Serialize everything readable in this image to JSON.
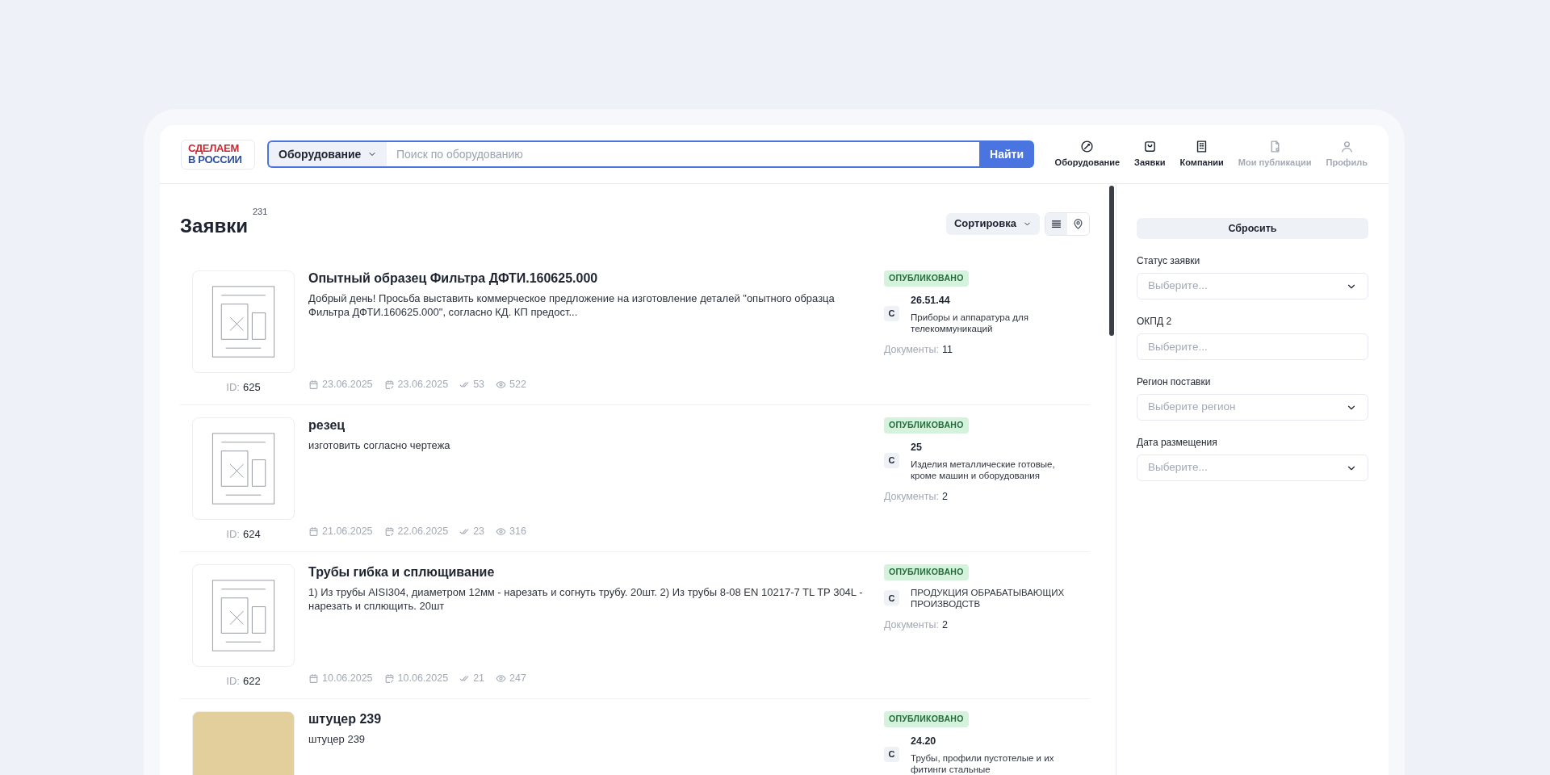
{
  "logo": [
    "СДЕЛАЕМ",
    "В РОССИИ"
  ],
  "search": {
    "category": "Оборудование",
    "placeholder": "Поиск по оборудованию",
    "button": "Найти"
  },
  "nav": [
    {
      "label": "Оборудование",
      "disabled": false
    },
    {
      "label": "Заявки",
      "disabled": false
    },
    {
      "label": "Компании",
      "disabled": false
    },
    {
      "label": "Мои публикации",
      "disabled": true
    },
    {
      "label": "Профиль",
      "disabled": true
    }
  ],
  "heading": {
    "title": "Заявки",
    "count": "231"
  },
  "sort": {
    "label": "Сортировка"
  },
  "view_toggle": [
    {
      "selected": true
    },
    {
      "selected": false
    }
  ],
  "requests": [
    {
      "kind": "drawing",
      "id_label": "ID:",
      "id": "625",
      "title": "Опытный образец Фильтра ДФТИ.160625.000",
      "description": "Добрый день! Просьба выставить коммерческое предложение на изготовление деталей \"опытного образца Фильтра ДФТИ.160625.000\", согласно КД. КП предост...",
      "created": "23.06.2025",
      "updated": "23.06.2025",
      "responses": "53",
      "views": "522",
      "status": "ОПУБЛИКОВАНО",
      "letter": "С",
      "code": "26.51.44",
      "category": "Приборы и аппаратура для телекоммуникаций",
      "documents_label": "Документы:",
      "documents": "11"
    },
    {
      "kind": "drawing",
      "id_label": "ID:",
      "id": "624",
      "title": "резец",
      "description": "изготовить согласно чертежа",
      "created": "21.06.2025",
      "updated": "22.06.2025",
      "responses": "23",
      "views": "316",
      "status": "ОПУБЛИКОВАНО",
      "letter": "С",
      "code": "25",
      "category": "Изделия металлические готовые, кроме машин и оборудования",
      "documents_label": "Документы:",
      "documents": "2"
    },
    {
      "kind": "drawing",
      "id_label": "ID:",
      "id": "622",
      "title": "Трубы гибка и сплющивание",
      "description": "1) Из трубы AISI304, диаметром 12мм - нарезать и согнуть трубу. 20шт. 2) Из трубы 8-08 EN 10217-7 TL TP 304L - нарезать и сплющить. 20шт",
      "created": "10.06.2025",
      "updated": "10.06.2025",
      "responses": "21",
      "views": "247",
      "status": "ОПУБЛИКОВАНО",
      "letter": "С",
      "category": "ПРОДУКЦИЯ ОБРАБАТЫВАЮЩИХ ПРОИЗВОДСТВ",
      "documents_label": "Документы:",
      "documents": "2"
    },
    {
      "kind": "photo",
      "title": "штуцер 239",
      "description": "штуцер 239",
      "status": "ОПУБЛИКОВАНО",
      "letter": "С",
      "code": "24.20",
      "category": "Трубы, профили пустотелые и их фитинги стальные"
    }
  ],
  "filters": {
    "reset": "Сбросить",
    "fields": [
      {
        "kind": "select",
        "label": "Статус заявки",
        "placeholder": "Выберите..."
      },
      {
        "kind": "input",
        "label": "ОКПД 2",
        "placeholder": "Выберите..."
      },
      {
        "kind": "select",
        "label": "Регион поставки",
        "placeholder": "Выберите регион"
      },
      {
        "kind": "select",
        "label": "Дата размещения",
        "placeholder": "Выберите..."
      }
    ]
  }
}
